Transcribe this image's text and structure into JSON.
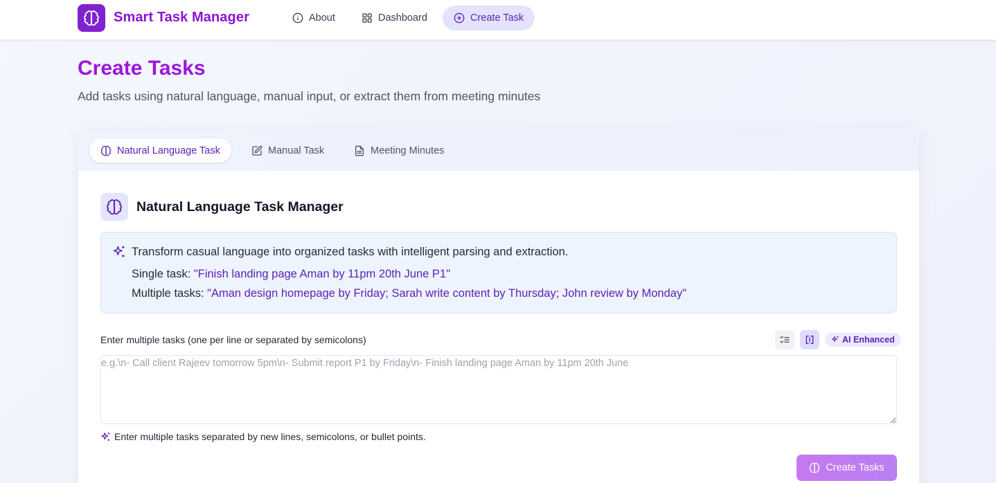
{
  "app": {
    "brand": "Smart Task Manager",
    "logo_icon": "brain-icon",
    "accent_color": "#8b12d6"
  },
  "nav": {
    "items": [
      {
        "label": "About",
        "icon": "info-icon",
        "active": false
      },
      {
        "label": "Dashboard",
        "icon": "grid-icon",
        "active": false
      },
      {
        "label": "Create Task",
        "icon": "plus-circle-icon",
        "active": true
      }
    ]
  },
  "page": {
    "title": "Create Tasks",
    "subtitle": "Add tasks using natural language, manual input, or extract them from meeting minutes"
  },
  "tabs": [
    {
      "label": "Natural Language Task",
      "icon": "brain-icon",
      "active": true
    },
    {
      "label": "Manual Task",
      "icon": "edit-icon",
      "active": false
    },
    {
      "label": "Meeting Minutes",
      "icon": "document-icon",
      "active": false
    }
  ],
  "section": {
    "title": "Natural Language Task Manager",
    "info": {
      "description": "Transform casual language into organized tasks with intelligent parsing and extraction.",
      "single_label": "Single task: ",
      "single_example": "\"Finish landing page Aman by 11pm 20th June P1\"",
      "multiple_label": "Multiple tasks: ",
      "multiple_example": "\"Aman design homepage by Friday; Sarah write content by Thursday; John review by Monday\""
    }
  },
  "form": {
    "label": "Enter multiple tasks (one per line or separated by semicolons)",
    "ai_badge": "AI Enhanced",
    "input_value": "",
    "placeholder": "e.g.\\n- Call client Rajeev tomorrow 5pm\\n- Submit report P1 by Friday\\n- Finish landing page Aman by 11pm 20th June",
    "hint": "Enter multiple tasks separated by new lines, semicolons, or bullet points.",
    "submit_label": "Create Tasks"
  }
}
